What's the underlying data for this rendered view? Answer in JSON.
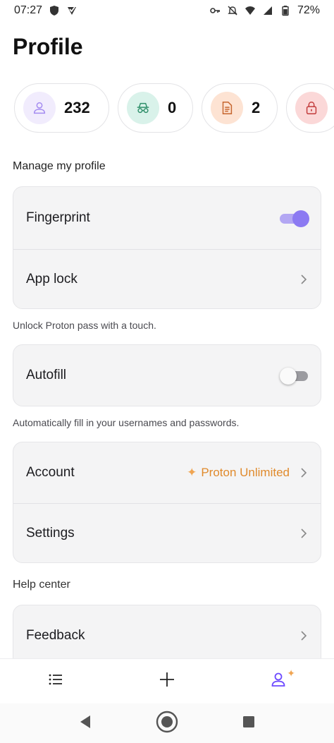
{
  "status_bar": {
    "time": "07:27",
    "battery": "72%"
  },
  "page": {
    "title": "Profile"
  },
  "counters": [
    {
      "name": "items",
      "value": "232",
      "icon": "user-icon",
      "bg": "#f1ecfd",
      "fg": "#a48bf0"
    },
    {
      "name": "aliases",
      "value": "0",
      "icon": "incognito-icon",
      "bg": "#d9f2ea",
      "fg": "#2f8f6a"
    },
    {
      "name": "notes",
      "value": "2",
      "icon": "note-icon",
      "bg": "#fde3d3",
      "fg": "#c6652e"
    },
    {
      "name": "locked",
      "value": "",
      "icon": "lock-icon",
      "bg": "#fbd8d8",
      "fg": "#c23b3b"
    }
  ],
  "manage": {
    "label": "Manage my profile",
    "fingerprint_label": "Fingerprint",
    "fingerprint_enabled": true,
    "app_lock_label": "App lock",
    "unlock_hint": "Unlock Proton pass with a touch."
  },
  "autofill": {
    "label": "Autofill",
    "enabled": false,
    "hint": "Automatically fill in your usernames and passwords."
  },
  "account": {
    "account_label": "Account",
    "plan_label": "Proton Unlimited",
    "settings_label": "Settings"
  },
  "help": {
    "label": "Help center",
    "feedback_label": "Feedback"
  },
  "colors": {
    "accent": "#8c7af2",
    "plan": "#e08a2c"
  }
}
